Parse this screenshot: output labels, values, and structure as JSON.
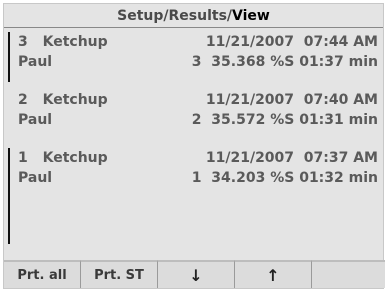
{
  "title": {
    "part1": "Setup/",
    "part2": "Results/",
    "active": "View"
  },
  "records": [
    {
      "index": "3",
      "product": "Ketchup",
      "date": "11/21/2007",
      "time": "07:44 AM",
      "user": "Paul",
      "count": "3",
      "result": "35.368",
      "unit": "%S",
      "duration": "01:37 min"
    },
    {
      "index": "2",
      "product": "Ketchup",
      "date": "11/21/2007",
      "time": "07:40 AM",
      "user": "Paul",
      "count": "2",
      "result": "35.572",
      "unit": "%S",
      "duration": "01:31 min"
    },
    {
      "index": "1",
      "product": "Ketchup",
      "date": "11/21/2007",
      "time": "07:37 AM",
      "user": "Paul",
      "count": "1",
      "result": "34.203",
      "unit": "%S",
      "duration": "01:32 min"
    }
  ],
  "footer": {
    "print_all": "Prt. all",
    "print_st": "Prt. ST",
    "down_icon": "down-arrow-icon",
    "up_icon": "up-arrow-icon"
  }
}
